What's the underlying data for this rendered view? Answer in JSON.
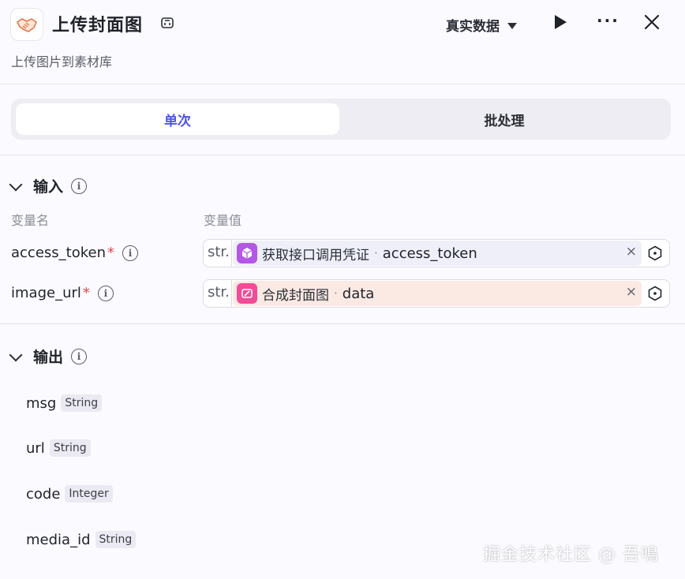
{
  "header": {
    "title": "上传封面图",
    "subtitle": "上传图片到素材库",
    "mode_label": "真实数据",
    "more_label": "···"
  },
  "tabs": [
    {
      "label": "单次",
      "active": true
    },
    {
      "label": "批处理",
      "active": false
    }
  ],
  "input": {
    "section_title": "输入",
    "col_name": "变量名",
    "col_value": "变量值",
    "rows": [
      {
        "name": "access_token",
        "required": "*",
        "type": "str.",
        "source": "获取接口调用凭证",
        "dot": "·",
        "field": "access_token",
        "chip_color": "#eeeff8",
        "icon_color": "#b456e8",
        "icon": "cube-icon"
      },
      {
        "name": "image_url",
        "required": "*",
        "type": "str.",
        "source": "合成封面图",
        "dot": "·",
        "field": "data",
        "chip_color": "#fbe9e4",
        "icon_color": "#f04c98",
        "icon": "image-edit-icon"
      }
    ]
  },
  "output": {
    "section_title": "输出",
    "rows": [
      {
        "name": "msg",
        "type": "String"
      },
      {
        "name": "url",
        "type": "String"
      },
      {
        "name": "code",
        "type": "Integer"
      },
      {
        "name": "media_id",
        "type": "String"
      }
    ]
  },
  "watermark": "掘金技术社区 @ 吾鳴"
}
